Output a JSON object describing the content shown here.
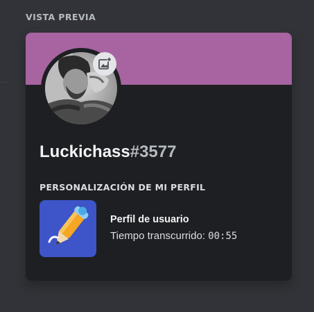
{
  "section": {
    "title": "VISTA PREVIA"
  },
  "profile": {
    "banner_color": "#a764a1",
    "username": "Luckichass",
    "discriminator": "#3577",
    "avatar_edit_icon": "add-image-icon"
  },
  "activity": {
    "section_title": "PERSONALIZACIÓN DE MI PERFIL",
    "name": "Perfil de usuario",
    "elapsed_label": "Tiempo transcurrido: ",
    "elapsed_value": "00:55",
    "art_icon": "pencil-icon",
    "art_background": "#3d55c8"
  }
}
